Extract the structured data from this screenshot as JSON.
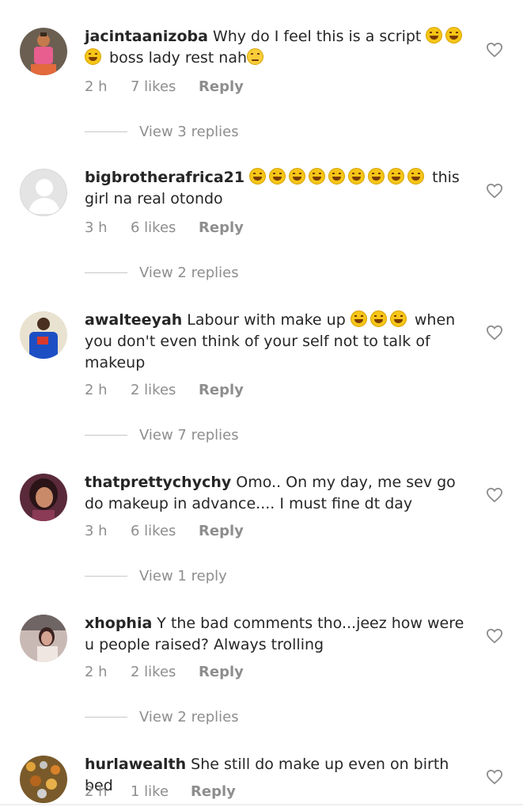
{
  "comments": [
    {
      "username": "jacintaanizoba",
      "text_before": "Why do I feel this is a script",
      "emojis_after": 2,
      "text_line2": "boss lady rest nah",
      "time": "2 h",
      "likes": "7 likes",
      "reply": "Reply",
      "view_replies": "View 3 replies"
    },
    {
      "username": "bigbrotherafrica21",
      "emojis_count": 9,
      "text": "this girl na real otondo",
      "time": "3 h",
      "likes": "6 likes",
      "reply": "Reply",
      "view_replies": "View 2 replies"
    },
    {
      "username": "awalteeyah",
      "text_before": "Labour with make up",
      "emojis_count": 3,
      "text_after": "when you don't even think of your self not to talk of makeup",
      "time": "2 h",
      "likes": "2 likes",
      "reply": "Reply",
      "view_replies": "View 7 replies"
    },
    {
      "username": "thatprettychychy",
      "text": "Omo.. On my day, me sev go do makeup in advance.... I must fine dt day",
      "time": "3 h",
      "likes": "6 likes",
      "reply": "Reply",
      "view_replies": "View 1 reply"
    },
    {
      "username": "xhophia",
      "text": "Y the bad comments tho...jeez how were u people raised? Always trolling",
      "time": "2 h",
      "likes": "2 likes",
      "reply": "Reply",
      "view_replies": "View 2 replies"
    },
    {
      "username": "hurlawealth",
      "text": "She still do make up even on birth bed",
      "time": "2 h",
      "likes": "1 like",
      "reply": "Reply"
    }
  ],
  "icons": {
    "like": "heart-outline-icon",
    "emoji_laugh": "grinning-sweat-emoji",
    "emoji_sad": "pleading-emoji"
  },
  "colors": {
    "text": "#262626",
    "secondary": "#8e8e8e",
    "divider": "#c7c7c7"
  }
}
